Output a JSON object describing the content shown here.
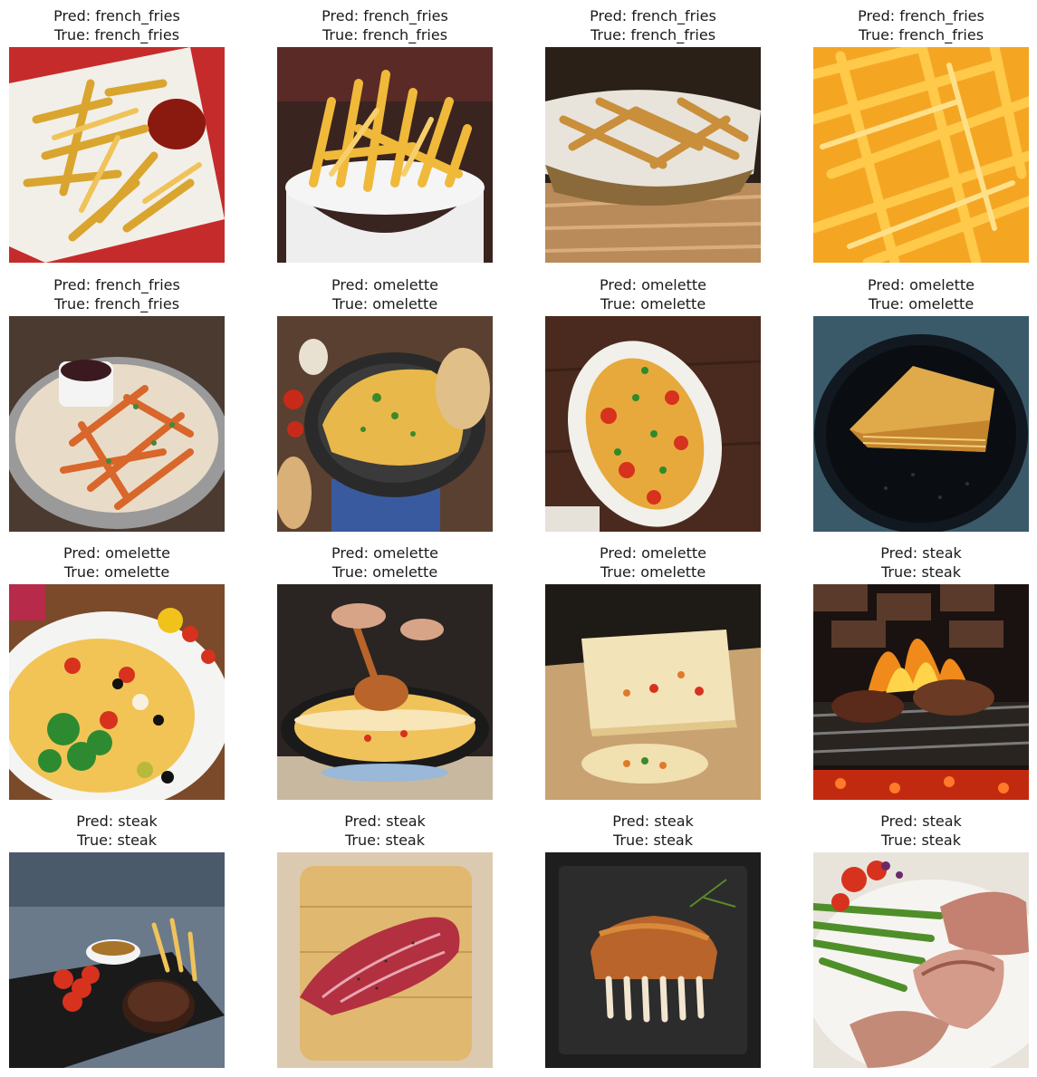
{
  "cells": [
    {
      "pred": "Pred: french_fries",
      "true": "True: french_fries",
      "icon": "french-fries-on-paper-with-ketchup-photo"
    },
    {
      "pred": "Pred: french_fries",
      "true": "True: french_fries",
      "icon": "french-fries-in-white-bowl-photo"
    },
    {
      "pred": "Pred: french_fries",
      "true": "True: french_fries",
      "icon": "french-fries-in-basket-photo"
    },
    {
      "pred": "Pred: french_fries",
      "true": "True: french_fries",
      "icon": "french-fries-closeup-photo"
    },
    {
      "pred": "Pred: french_fries",
      "true": "True: french_fries",
      "icon": "sweet-potato-fries-with-dip-photo"
    },
    {
      "pred": "Pred: omelette",
      "true": "True: omelette",
      "icon": "omelette-in-pan-with-toast-photo"
    },
    {
      "pred": "Pred: omelette",
      "true": "True: omelette",
      "icon": "omelette-with-tomatoes-on-plate-photo"
    },
    {
      "pred": "Pred: omelette",
      "true": "True: omelette",
      "icon": "layered-omelette-on-dark-plate-photo"
    },
    {
      "pred": "Pred: omelette",
      "true": "True: omelette",
      "icon": "omelette-with-salad-and-olives-photo"
    },
    {
      "pred": "Pred: omelette",
      "true": "True: omelette",
      "icon": "omelette-being-folded-in-pan-photo"
    },
    {
      "pred": "Pred: omelette",
      "true": "True: omelette",
      "icon": "rolled-omelette-on-board-photo"
    },
    {
      "pred": "Pred: steak",
      "true": "True: steak",
      "icon": "steaks-on-fire-grill-photo"
    },
    {
      "pred": "Pred: steak",
      "true": "True: steak",
      "icon": "steak-with-tomatoes-and-sauce-photo"
    },
    {
      "pred": "Pred: steak",
      "true": "True: steak",
      "icon": "raw-steak-on-cutting-board-photo"
    },
    {
      "pred": "Pred: steak",
      "true": "True: steak",
      "icon": "rack-of-ribs-on-slate-photo"
    },
    {
      "pred": "Pred: steak",
      "true": "True: steak",
      "icon": "sliced-steak-with-asparagus-photo"
    }
  ]
}
